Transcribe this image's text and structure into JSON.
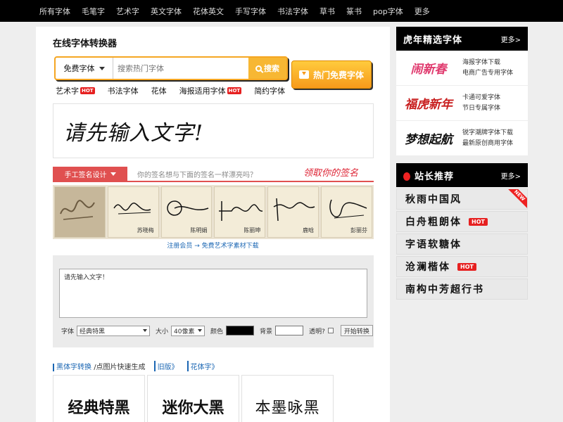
{
  "nav": [
    "所有字体",
    "毛笔字",
    "艺术字",
    "英文字体",
    "花体英文",
    "手写字体",
    "书法字体",
    "草书",
    "篆书",
    "pop字体",
    "更多"
  ],
  "main": {
    "title": "在线字体转换器",
    "search": {
      "select_label": "免费字体",
      "placeholder": "搜索热门字体",
      "button": "搜索"
    },
    "hot_button": "热门免费字体",
    "tags": [
      {
        "label": "艺术字",
        "hot": "HOT"
      },
      {
        "label": "书法字体",
        "hot": ""
      },
      {
        "label": "花体",
        "hot": ""
      },
      {
        "label": "海报适用字体",
        "hot": "HOT"
      },
      {
        "label": "简约字体",
        "hot": ""
      }
    ],
    "preview_text": "请先输入文字!",
    "signature": {
      "tab": "手工签名设计",
      "question": "你的签名想与下面的签名一样漂亮吗？",
      "cta": "领取你的签名",
      "names": [
        "",
        "苏晓梅",
        "陈明娟",
        "陈丽坤",
        "鹿晗",
        "彭丽芬"
      ],
      "link": "注册会员 → 免费艺术字素材下载"
    },
    "converter": {
      "text": "请先输入文字！",
      "font_label": "字体",
      "font_value": "经典特黑",
      "size_label": "大小",
      "size_value": "40像素",
      "color_label": "颜色",
      "bg_label": "背景",
      "transparent_label": "透明?",
      "start_button": "开始转换",
      "color": "#000000",
      "bg": "#ffffff"
    },
    "links": {
      "l1": "黑体字转换",
      "l1_note": "/点图片快速生成",
      "l2": "旧版》",
      "l3": "花体字》"
    },
    "font_cards": [
      "经典特黑",
      "迷你大黑",
      "本墨咏黑"
    ]
  },
  "sidebar": {
    "section1": {
      "title": "虎年精选字体",
      "more": "更多>",
      "items": [
        {
          "image_text": "闹新春",
          "line1": "海报字体下载",
          "line2": "电商广告专用字体",
          "color": "#e03a6e"
        },
        {
          "image_text": "福虎新年",
          "line1": "卡通可爱字体",
          "line2": "节日专属字体",
          "color": "#c81e1e"
        },
        {
          "image_text": "梦想起航",
          "line1": "锐字潮牌字体下载",
          "line2": "最新原创商用字体",
          "color": "#111111"
        }
      ]
    },
    "section2": {
      "title": "站长推荐",
      "more": "更多>",
      "ribbon": "NEW",
      "items": [
        {
          "label": "秋雨中国风",
          "hot": ""
        },
        {
          "label": "白舟粗朗体",
          "hot": "HOT"
        },
        {
          "label": "字语软糖体",
          "hot": ""
        },
        {
          "label": "沧澜楷体",
          "hot": "HOT"
        },
        {
          "label": "南构中芳超行书",
          "hot": ""
        }
      ]
    }
  }
}
